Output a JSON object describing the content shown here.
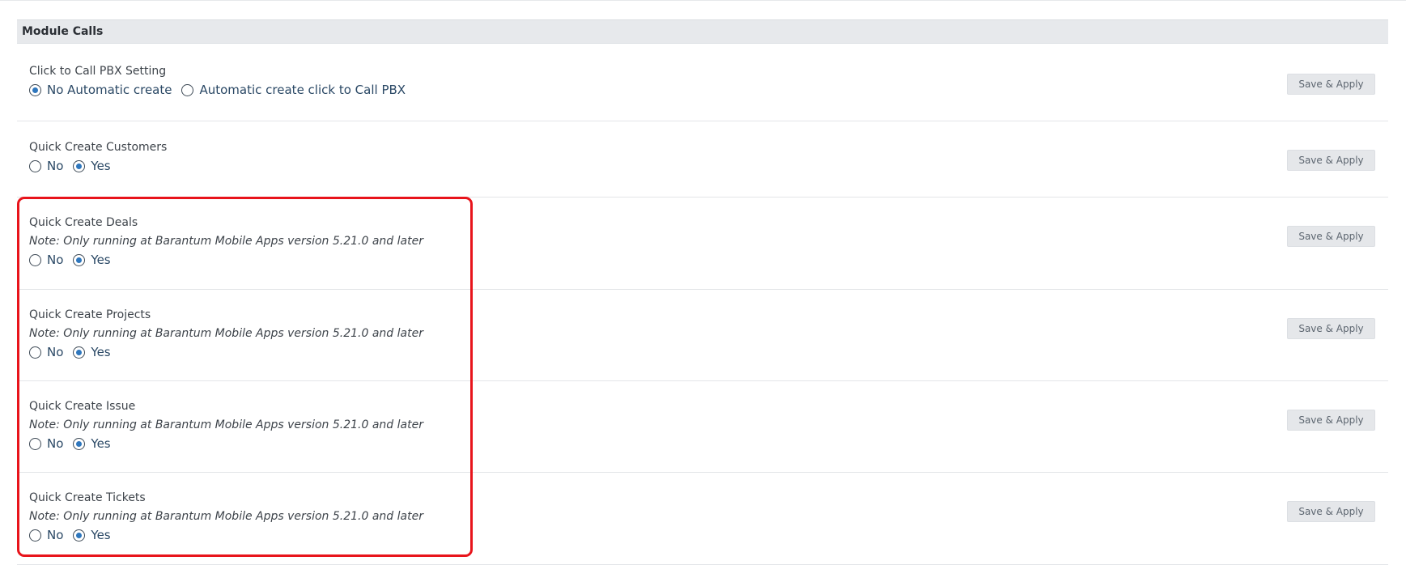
{
  "section_title": "Module Calls",
  "save_label": "Save & Apply",
  "rows": [
    {
      "label": "Click to Call PBX Setting",
      "note": "",
      "options": [
        "No Automatic create",
        "Automatic create click to Call PBX"
      ],
      "selected": 0
    },
    {
      "label": "Quick Create Customers",
      "note": "",
      "options": [
        "No",
        "Yes"
      ],
      "selected": 1
    },
    {
      "label": "Quick Create Deals",
      "note": "Note: Only running at Barantum Mobile Apps version 5.21.0 and later",
      "options": [
        "No",
        "Yes"
      ],
      "selected": 1
    },
    {
      "label": "Quick Create Projects",
      "note": "Note: Only running at Barantum Mobile Apps version 5.21.0 and later",
      "options": [
        "No",
        "Yes"
      ],
      "selected": 1
    },
    {
      "label": "Quick Create Issue",
      "note": "Note: Only running at Barantum Mobile Apps version 5.21.0 and later",
      "options": [
        "No",
        "Yes"
      ],
      "selected": 1
    },
    {
      "label": "Quick Create Tickets",
      "note": "Note: Only running at Barantum Mobile Apps version 5.21.0 and later",
      "options": [
        "No",
        "Yes"
      ],
      "selected": 1
    }
  ],
  "colors": {
    "highlight": "#e8141b",
    "radio_dot": "#2f77bd",
    "header_bg": "#e7e9ec"
  }
}
